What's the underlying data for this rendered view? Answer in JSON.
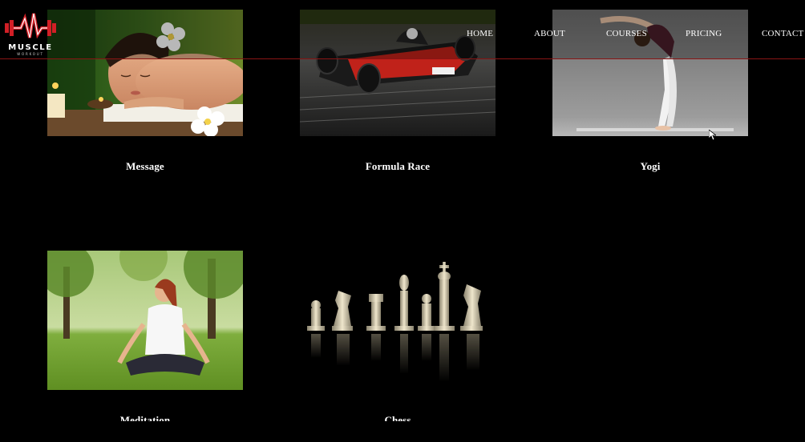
{
  "brand": {
    "name": "MUSCLE",
    "tagline": "WORKOUT",
    "accent_color": "#d21f26"
  },
  "nav": {
    "items": [
      {
        "label": "HOME"
      },
      {
        "label": "ABOUT"
      },
      {
        "label": "COURSES"
      },
      {
        "label": "PRICING"
      },
      {
        "label": "CONTACT"
      }
    ]
  },
  "courses": [
    {
      "title": "Message",
      "image": "spa-massage-photo"
    },
    {
      "title": "Formula Race",
      "image": "race-car-photo"
    },
    {
      "title": "Yogi",
      "image": "yoga-pose-photo"
    },
    {
      "title": "Meditation",
      "image": "meditation-photo"
    },
    {
      "title": "Chess",
      "image": "chess-pieces-photo"
    }
  ]
}
